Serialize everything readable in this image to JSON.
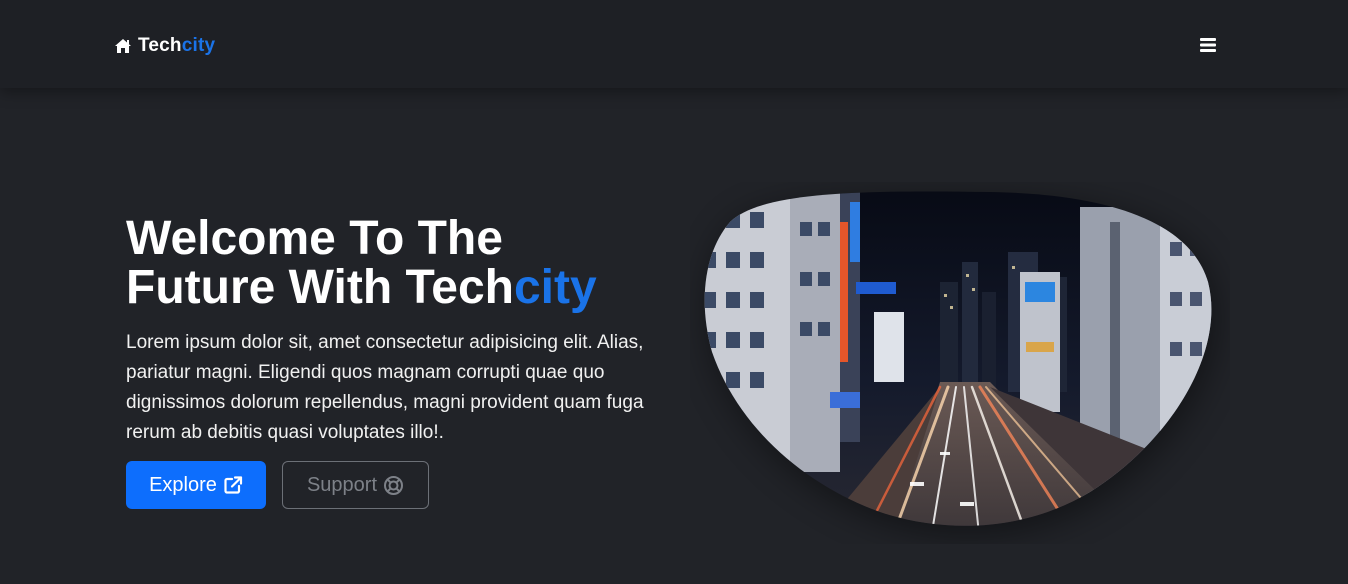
{
  "navbar": {
    "brand_prefix": "Tech",
    "brand_accent": "city",
    "home_icon": "home-icon",
    "menu_icon": "hamburger-menu-icon",
    "extension_icon": "browser-extension-icon"
  },
  "hero": {
    "title_line1": "Welcome To The",
    "title_line2_prefix": "Future With Tech",
    "title_line2_accent": "city",
    "description": "Lorem ipsum dolor sit, amet consectetur adipisicing elit. Alias, pariatur magni. Eligendi quos magnam corrupti quae quo dignissimos dolorum repellendus, magni provident quam fuga rerum ab debitis quasi voluptates illo!.",
    "explore_label": "Explore",
    "explore_icon": "external-link-icon",
    "support_label": "Support",
    "support_icon": "life-ring-icon",
    "image_subject": "city-night-street-image"
  },
  "colors": {
    "background": "#212328",
    "navbar": "#1e2025",
    "accent": "#1a73e8",
    "primary_button": "#0d6efd",
    "secondary_border": "#6c7077",
    "text": "#ffffff"
  }
}
